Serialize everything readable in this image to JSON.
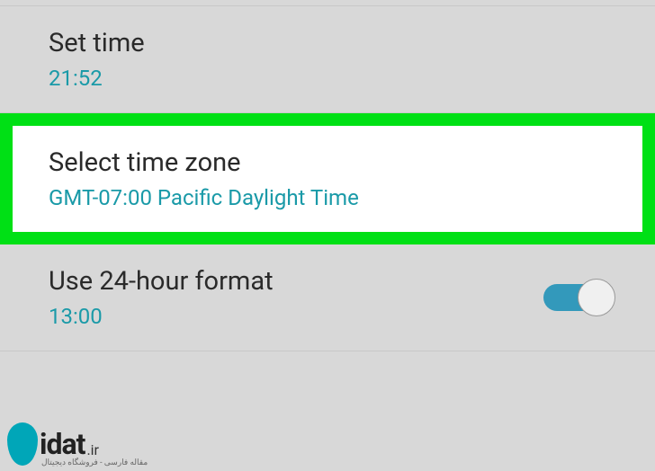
{
  "settings": {
    "set_time": {
      "title": "Set time",
      "value": "21:52"
    },
    "select_timezone": {
      "title": "Select time zone",
      "value": "GMT-07:00 Pacific Daylight Time"
    },
    "use_24hr": {
      "title": "Use 24-hour format",
      "value": "13:00",
      "toggle_on": true
    }
  },
  "watermark": {
    "brand": "idat",
    "suffix": ".ir",
    "tagline": "مقاله فارسی - فروشگاه دیجیتال"
  }
}
